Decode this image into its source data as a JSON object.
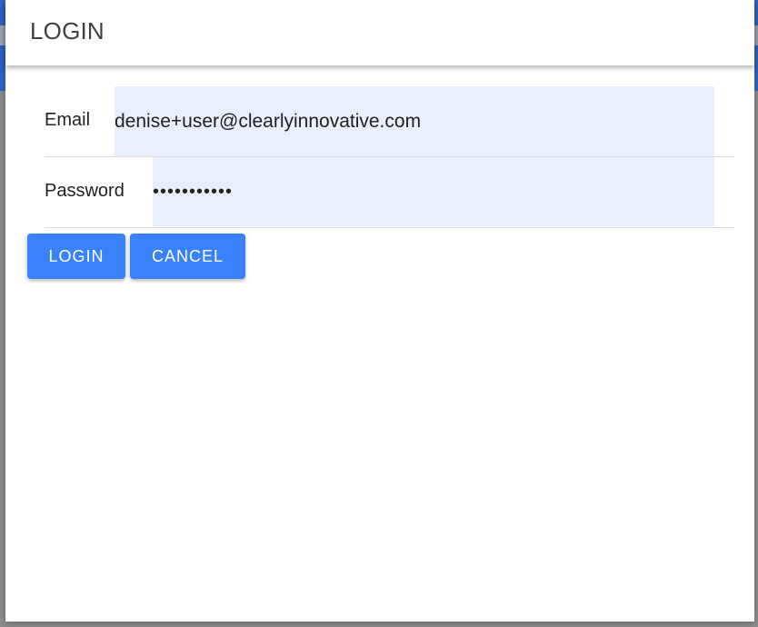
{
  "dialog": {
    "title": "LOGIN"
  },
  "form": {
    "email": {
      "label": "Email",
      "value": "denise+user@clearlyinnovative.com"
    },
    "password": {
      "label": "Password",
      "value": "•••••••••••"
    }
  },
  "actions": {
    "login_label": "LOGIN",
    "cancel_label": "CANCEL"
  },
  "colors": {
    "accent": "#3a82fb",
    "input_background": "#e8effb",
    "backdrop": "#8c8c8c"
  }
}
